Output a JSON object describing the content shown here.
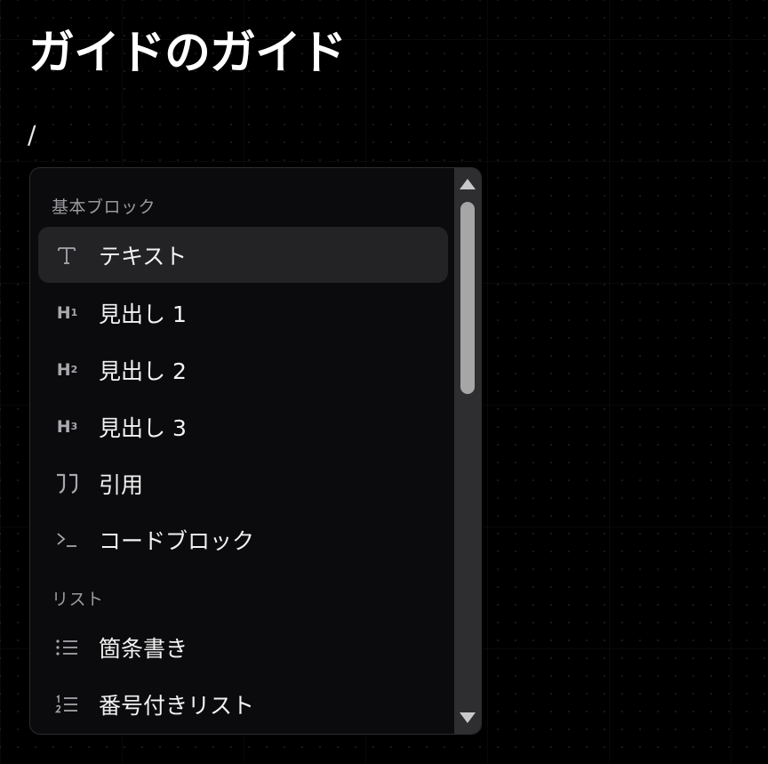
{
  "page": {
    "title": "ガイドのガイド",
    "input_text": "/"
  },
  "menu": {
    "sections": [
      {
        "label": "基本ブロック",
        "items": [
          {
            "label": "テキスト",
            "icon": "text-icon",
            "active": true
          },
          {
            "label": "見出し 1",
            "icon": "heading-1-icon"
          },
          {
            "label": "見出し 2",
            "icon": "heading-2-icon"
          },
          {
            "label": "見出し 3",
            "icon": "heading-3-icon"
          },
          {
            "label": "引用",
            "icon": "quote-icon"
          },
          {
            "label": "コードブロック",
            "icon": "code-icon"
          }
        ]
      },
      {
        "label": "リスト",
        "items": [
          {
            "label": "箇条書き",
            "icon": "bullet-list-icon"
          },
          {
            "label": "番号付きリスト",
            "icon": "numbered-list-icon"
          }
        ]
      }
    ]
  },
  "icons": {
    "h1": {
      "letter": "H",
      "num": "1"
    },
    "h2": {
      "letter": "H",
      "num": "2"
    },
    "h3": {
      "letter": "H",
      "num": "3"
    }
  },
  "colors": {
    "background": "#000000",
    "menu_bg": "#0b0b0d",
    "active_item": "#232326",
    "section_label": "#9a9a9f",
    "scrollbar_track": "#2e2e31",
    "scrollbar_thumb": "#a6a6a6"
  }
}
